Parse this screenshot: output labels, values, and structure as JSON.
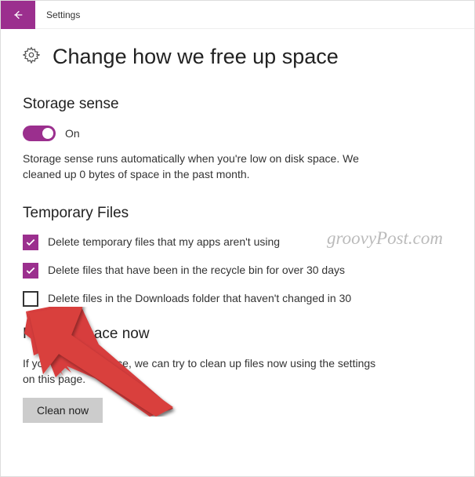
{
  "titlebar": {
    "label": "Settings"
  },
  "page": {
    "title": "Change how we free up space"
  },
  "storage_sense": {
    "heading": "Storage sense",
    "toggle_state": "On",
    "description": "Storage sense runs automatically when you're low on disk space. We cleaned up 0 bytes of space in the past month."
  },
  "temp_files": {
    "heading": "Temporary Files",
    "items": [
      {
        "checked": true,
        "label": "Delete temporary files that my apps aren't using"
      },
      {
        "checked": true,
        "label": "Delete files that have been in the recycle bin for over 30 days"
      },
      {
        "checked": false,
        "label": "Delete files in the Downloads folder that haven't changed in 30"
      }
    ]
  },
  "free_up": {
    "heading": "Free up space now",
    "description": "If you're low on space, we can try to clean up files now using the settings on this page.",
    "button": "Clean now"
  },
  "watermark": "groovyPost.com"
}
